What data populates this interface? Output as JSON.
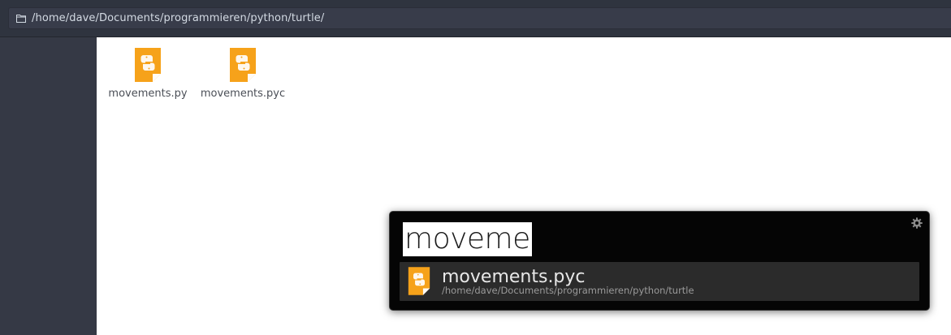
{
  "pathbar": {
    "icon": "folder-icon",
    "path": "/home/dave/Documents/programmieren/python/turtle/"
  },
  "files": [
    {
      "name": "movements.py",
      "icon": "python-file-icon"
    },
    {
      "name": "movements.pyc",
      "icon": "python-file-icon"
    }
  ],
  "launcher": {
    "query": "moveme",
    "settings_icon": "gear-icon",
    "results": [
      {
        "name": "movements.pyc",
        "path": "/home/dave/Documents/programmieren/python/turtle",
        "icon": "python-file-icon"
      }
    ]
  },
  "colors": {
    "topbar": "#2f343f",
    "pathbar": "#383c4a",
    "sidebar": "#353945",
    "file_icon": "#f6a21a",
    "launcher_bg": "#050505",
    "result_bg": "#2b2b2b"
  }
}
